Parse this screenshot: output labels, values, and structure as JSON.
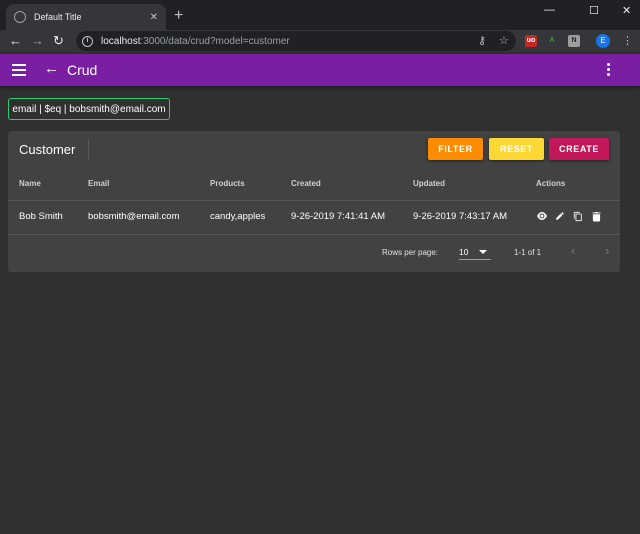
{
  "browser": {
    "tab_title": "Default Title",
    "tab_close": "✕",
    "new_tab": "+",
    "url_host": "localhost",
    "url_path": ":3000/data/crud?model=customer",
    "profile_initial": "E",
    "win_min": "—",
    "win_max": "☐",
    "win_close": "✕"
  },
  "appbar": {
    "title": "Crud",
    "color": "#7b1fa2"
  },
  "filter_chip": {
    "text": "email | $eq | bobsmith@email.com"
  },
  "card": {
    "title": "Customer",
    "buttons": {
      "filter": "FILTER",
      "reset": "RESET",
      "create": "CREATE"
    },
    "columns": [
      "Name",
      "Email",
      "Products",
      "Created",
      "Updated",
      "Actions"
    ],
    "rows": [
      {
        "name": "Bob Smith",
        "email": "bobsmith@email.com",
        "products": "candy,apples",
        "created": "9-26-2019 7:41:41 AM",
        "updated": "9-26-2019 7:43:17 AM"
      }
    ],
    "pagination": {
      "rows_per_page_label": "Rows per page:",
      "rows_per_page": "10",
      "range": "1-1 of 1"
    }
  },
  "colors": {
    "filter_button": "#fb8c00",
    "reset_button": "#fdd835",
    "create_button": "#c2185b",
    "chip_border": "#2ecc71"
  }
}
